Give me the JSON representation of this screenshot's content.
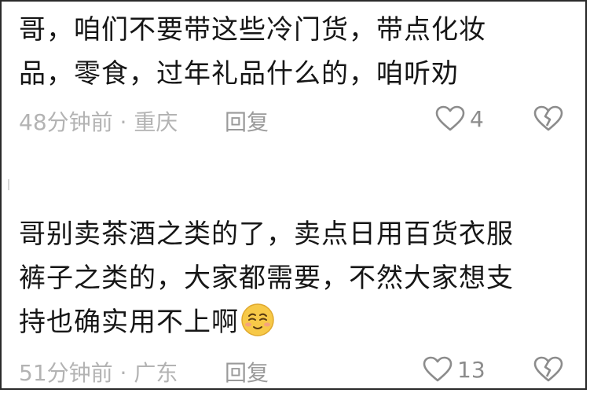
{
  "comments": [
    {
      "text": "哥，咱们不要带这些冷门货，带点化妆\n品，零食，过年礼品什么的，咱听劝",
      "time_location": "48分钟前 · 重庆",
      "reply_label": "回复",
      "like_count": "4"
    },
    {
      "text": "哥别卖茶酒之类的了，卖点日用百货衣服\n裤子之类的，大家都需要，不然大家想支\n持也确实用不上啊",
      "emoji": "smiling-face-emoji",
      "time_location": "51分钟前 · 广东",
      "reply_label": "回复",
      "like_count": "13"
    }
  ],
  "icons": {
    "like": "heart-outline-icon",
    "dislike": "broken-heart-icon"
  },
  "colors": {
    "text": "#161616",
    "meta": "#b3b3b3",
    "icon": "#8c8c8c",
    "emoji_face": "#f7c948"
  }
}
